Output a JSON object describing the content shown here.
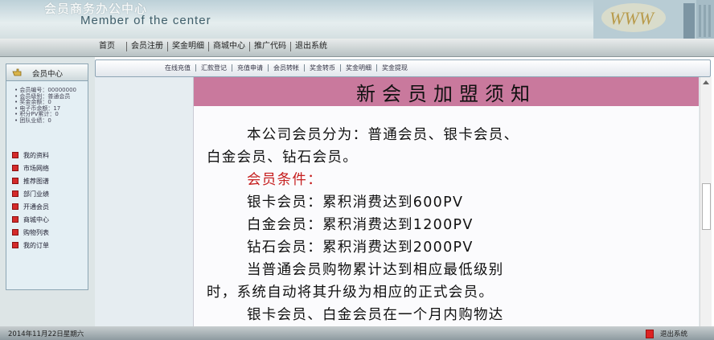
{
  "header": {
    "brand_cn": "会员商务办公中心",
    "brand_en": "Member of the center"
  },
  "nav": {
    "items": [
      "首页",
      "会员注册",
      "奖金明细",
      "商城中心",
      "推广代码",
      "退出系统"
    ]
  },
  "sidebar": {
    "title": "会员中心",
    "info": [
      "• 会员编号：00000000",
      "• 会员级别：普通会员",
      "• 奖金余额：0",
      "• 电子币余额：17",
      "• 积分PV累计：0",
      "• 团队业绩：0"
    ],
    "menu": [
      "我的资料",
      "市场网络",
      "推荐图谱",
      "部门业绩",
      "开通会员",
      "商城中心",
      "购物列表",
      "我的订单"
    ]
  },
  "subnav": {
    "items": [
      "在线充值",
      "汇款登记",
      "充值申请",
      "会员转帐",
      "奖金转币",
      "奖金明细",
      "奖金提现"
    ]
  },
  "document": {
    "title": "新会员加盟须知",
    "lines": [
      "本公司会员分为：普通会员、银卡会员、",
      "白金会员、钻石会员。",
      "会员条件：",
      "银卡会员：累积消费达到600PV",
      "白金会员：累积消费达到1200PV",
      "钻石会员：累积消费达到2000PV",
      "当普通会员购物累计达到相应最低级别",
      "时，系统自动将其升级为相应的正式会员。",
      "银卡会员、白金会员在一个月内购物达"
    ]
  },
  "footer": {
    "date": "2014年11月22日星期六",
    "logout": "退出系统"
  },
  "colors": {
    "title_band": "#c9799d",
    "highlight_red": "#c62020",
    "menu_bullet": "#d42a2a"
  }
}
